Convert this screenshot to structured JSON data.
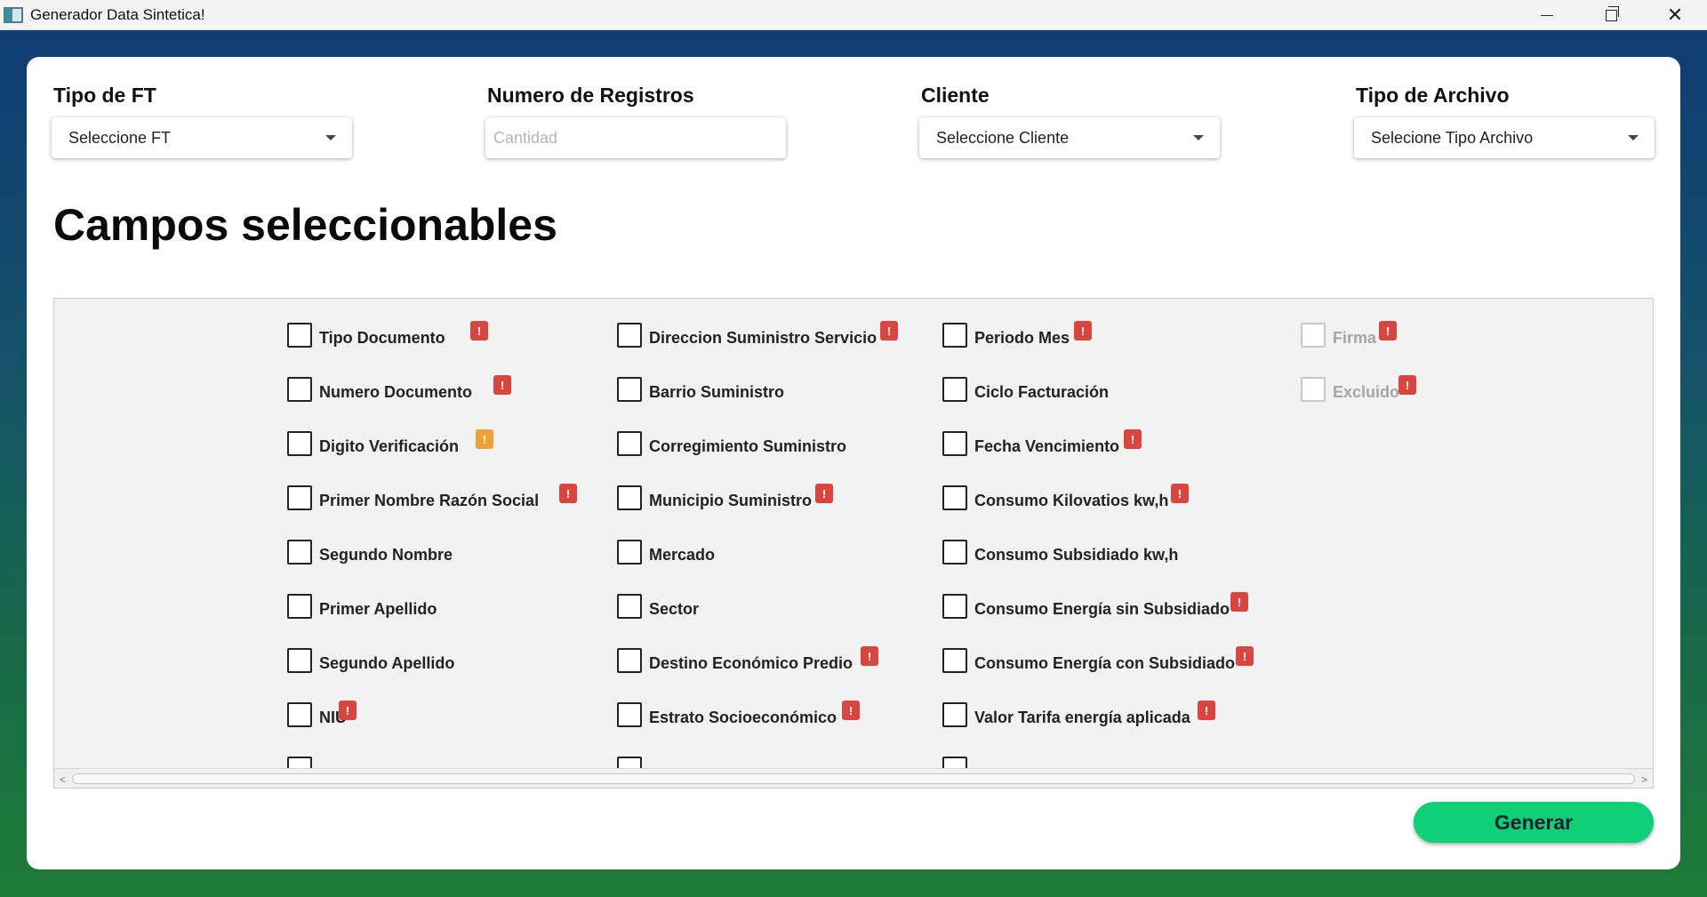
{
  "window": {
    "title": "Generador Data Sintetica!",
    "controls": {
      "minimize": "minimize-icon",
      "restore": "restore-icon",
      "close": "close-icon"
    }
  },
  "form": {
    "tipo_ft": {
      "label": "Tipo de FT",
      "value": "Seleccione FT"
    },
    "num_registros": {
      "label": "Numero de Registros",
      "placeholder": "Cantidad",
      "value": ""
    },
    "cliente": {
      "label": "Cliente",
      "value": "Seleccione Cliente"
    },
    "tipo_archivo": {
      "label": "Tipo de Archivo",
      "value": "Selecione Tipo Archivo"
    }
  },
  "section_title": "Campos seleccionables",
  "columns": [
    [
      {
        "label": "Tipo Documento",
        "warn": "red",
        "warn_mark": "!"
      },
      {
        "label": "Numero Documento",
        "warn": "red",
        "warn_mark": "!"
      },
      {
        "label": "Digito Verificación",
        "warn": "orange",
        "warn_mark": "!"
      },
      {
        "label": "Primer Nombre Razón Social",
        "warn": "red",
        "warn_mark": "!"
      },
      {
        "label": "Segundo Nombre",
        "warn": null
      },
      {
        "label": "Primer Apellido",
        "warn": null
      },
      {
        "label": "Segundo Apellido",
        "warn": null
      },
      {
        "label": "NIU",
        "warn": "red",
        "warn_mark": "!"
      }
    ],
    [
      {
        "label": "Direccion Suministro Servicio",
        "warn": "red",
        "warn_mark": "!"
      },
      {
        "label": "Barrio Suministro",
        "warn": null
      },
      {
        "label": "Corregimiento Suministro",
        "warn": null
      },
      {
        "label": "Municipio Suministro",
        "warn": "red",
        "warn_mark": "!"
      },
      {
        "label": "Mercado",
        "warn": null
      },
      {
        "label": "Sector",
        "warn": null
      },
      {
        "label": "Destino Económico Predio",
        "warn": "red",
        "warn_mark": "!"
      },
      {
        "label": "Estrato Socioeconómico",
        "warn": "red",
        "warn_mark": "!"
      }
    ],
    [
      {
        "label": "Periodo Mes",
        "warn": "red",
        "warn_mark": "!"
      },
      {
        "label": "Ciclo Facturación",
        "warn": null
      },
      {
        "label": "Fecha Vencimiento",
        "warn": "red",
        "warn_mark": "!"
      },
      {
        "label": "Consumo Kilovatios kw,h",
        "warn": "red",
        "warn_mark": "!"
      },
      {
        "label": "Consumo Subsidiado kw,h",
        "warn": null
      },
      {
        "label": "Consumo Energía sin Subsidiado",
        "warn": "red",
        "warn_mark": "!"
      },
      {
        "label": "Consumo Energía con Subsidiado",
        "warn": "red",
        "warn_mark": "!"
      },
      {
        "label": "Valor Tarifa energía aplicada",
        "warn": "red",
        "warn_mark": "!"
      }
    ],
    [
      {
        "label": "Firma",
        "warn": "red",
        "warn_mark": "!",
        "disabled": true
      },
      {
        "label": "Excluido",
        "warn": "red",
        "warn_mark": "!",
        "disabled": true
      }
    ]
  ],
  "generate_label": "Generar",
  "colors": {
    "accent": "#0fcf77",
    "warn_red": "#d9453f",
    "warn_orange": "#f0a038"
  }
}
